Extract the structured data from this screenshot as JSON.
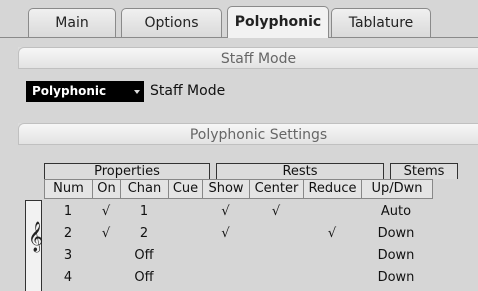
{
  "tabs": [
    {
      "label": "Main",
      "active": false
    },
    {
      "label": "Options",
      "active": false
    },
    {
      "label": "Polyphonic",
      "active": true
    },
    {
      "label": "Tablature",
      "active": false
    }
  ],
  "staff_mode": {
    "header": "Staff Mode",
    "dropdown_value": "Polyphonic",
    "label": "Staff Mode"
  },
  "polyphonic_settings": {
    "header": "Polyphonic Settings",
    "groups": {
      "properties": "Properties",
      "rests": "Rests",
      "stems": "Stems"
    },
    "columns": [
      "Num",
      "On",
      "Chan",
      "Cue",
      "Show",
      "Center",
      "Reduce",
      "Up/Dwn"
    ],
    "clef_icon": "treble-clef",
    "rows": [
      {
        "num": "1",
        "on": "√",
        "chan": "1",
        "cue": "",
        "show": "√",
        "center": "√",
        "reduce": "",
        "stems": "Auto"
      },
      {
        "num": "2",
        "on": "√",
        "chan": "2",
        "cue": "",
        "show": "√",
        "center": "",
        "reduce": "√",
        "stems": "Down"
      },
      {
        "num": "3",
        "on": "",
        "chan": "Off",
        "cue": "",
        "show": "",
        "center": "",
        "reduce": "",
        "stems": "Down"
      },
      {
        "num": "4",
        "on": "",
        "chan": "Off",
        "cue": "",
        "show": "",
        "center": "",
        "reduce": "",
        "stems": "Down"
      }
    ]
  }
}
